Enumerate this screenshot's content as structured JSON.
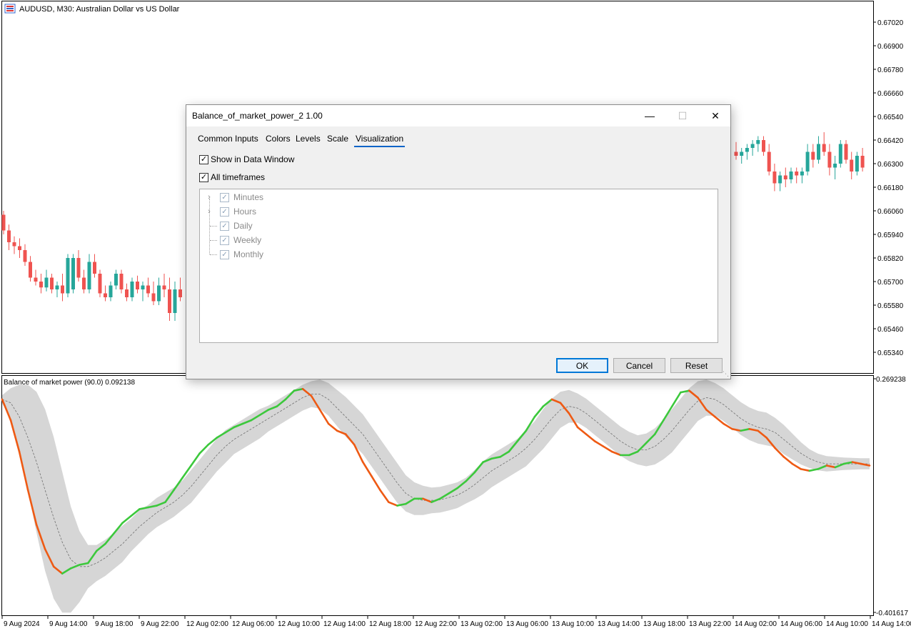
{
  "chart": {
    "symbol_title": "AUDUSD, M30:  Australian Dollar vs US Dollar",
    "price_ticks": [
      "0.67020",
      "0.66900",
      "0.66780",
      "0.66660",
      "0.66540",
      "0.66420",
      "0.66300",
      "0.66180",
      "0.66060",
      "0.65940",
      "0.65820",
      "0.65700",
      "0.65580",
      "0.65460",
      "0.65340"
    ],
    "indicator_title": "Balance of market power (90.0) 0.092138",
    "indicator_ticks": [
      "0.269238",
      "-0.401617"
    ],
    "time_ticks": [
      "9 Aug 2024",
      "9 Aug 14:00",
      "9 Aug 18:00",
      "9 Aug 22:00",
      "12 Aug 02:00",
      "12 Aug 06:00",
      "12 Aug 10:00",
      "12 Aug 14:00",
      "12 Aug 18:00",
      "12 Aug 22:00",
      "13 Aug 02:00",
      "13 Aug 06:00",
      "13 Aug 10:00",
      "13 Aug 14:00",
      "13 Aug 18:00",
      "13 Aug 22:00",
      "14 Aug 02:00",
      "14 Aug 06:00",
      "14 Aug 10:00",
      "14 Aug 14:00"
    ],
    "colors": {
      "bull": "#26a69a",
      "bear": "#ef5350",
      "up_line": "#3cc83c",
      "down_line": "#ee5a14",
      "band": "#d6d6d6",
      "signal": "#707070"
    },
    "candles_left": [
      [
        0.6604,
        0.6606,
        0.6594,
        0.6596
      ],
      [
        0.6596,
        0.6599,
        0.6586,
        0.659
      ],
      [
        0.659,
        0.6593,
        0.6584,
        0.6588
      ],
      [
        0.6588,
        0.6592,
        0.6582,
        0.6586
      ],
      [
        0.6586,
        0.6589,
        0.6578,
        0.658
      ],
      [
        0.658,
        0.6583,
        0.657,
        0.6572
      ],
      [
        0.6572,
        0.6576,
        0.6568,
        0.657
      ],
      [
        0.657,
        0.6574,
        0.6564,
        0.6567
      ],
      [
        0.6567,
        0.6576,
        0.6565,
        0.6572
      ],
      [
        0.6572,
        0.6574,
        0.6564,
        0.6566
      ],
      [
        0.6566,
        0.657,
        0.6562,
        0.6568
      ],
      [
        0.6568,
        0.6574,
        0.656,
        0.6564
      ],
      [
        0.6564,
        0.6584,
        0.6562,
        0.6582
      ],
      [
        0.6566,
        0.6584,
        0.6564,
        0.6582
      ],
      [
        0.6582,
        0.6586,
        0.657,
        0.6572
      ],
      [
        0.6572,
        0.6576,
        0.6564,
        0.6566
      ],
      [
        0.6566,
        0.6584,
        0.6564,
        0.658
      ],
      [
        0.658,
        0.6584,
        0.6572,
        0.6574
      ],
      [
        0.6574,
        0.6576,
        0.6562,
        0.6564
      ],
      [
        0.6564,
        0.6568,
        0.656,
        0.6562
      ],
      [
        0.6562,
        0.657,
        0.656,
        0.6568
      ],
      [
        0.6568,
        0.6576,
        0.6566,
        0.6574
      ],
      [
        0.6574,
        0.6576,
        0.6564,
        0.6566
      ],
      [
        0.6566,
        0.6569,
        0.656,
        0.6562
      ],
      [
        0.6562,
        0.6572,
        0.656,
        0.657
      ],
      [
        0.657,
        0.6573,
        0.6564,
        0.6566
      ],
      [
        0.6566,
        0.657,
        0.656,
        0.6568
      ],
      [
        0.6568,
        0.6572,
        0.6562,
        0.6564
      ],
      [
        0.6564,
        0.657,
        0.6558,
        0.656
      ],
      [
        0.656,
        0.6572,
        0.6558,
        0.6568
      ],
      [
        0.6568,
        0.6574,
        0.6562,
        0.6566
      ],
      [
        0.6566,
        0.6572,
        0.655,
        0.6554
      ],
      [
        0.6554,
        0.657,
        0.655,
        0.6566
      ],
      [
        0.6566,
        0.6572,
        0.656,
        0.6562
      ]
    ],
    "candles_right": [
      [
        0.6636,
        0.6641,
        0.6632,
        0.6634
      ],
      [
        0.6634,
        0.6638,
        0.663,
        0.6636
      ],
      [
        0.6636,
        0.664,
        0.6632,
        0.6638
      ],
      [
        0.6638,
        0.6642,
        0.6634,
        0.664
      ],
      [
        0.664,
        0.6644,
        0.6636,
        0.6642
      ],
      [
        0.6642,
        0.6644,
        0.6634,
        0.6636
      ],
      [
        0.6636,
        0.664,
        0.6624,
        0.6626
      ],
      [
        0.6626,
        0.663,
        0.6616,
        0.662
      ],
      [
        0.662,
        0.6626,
        0.6616,
        0.6624
      ],
      [
        0.6624,
        0.6628,
        0.6618,
        0.6622
      ],
      [
        0.6622,
        0.6628,
        0.662,
        0.6626
      ],
      [
        0.6626,
        0.6628,
        0.662,
        0.6624
      ],
      [
        0.6624,
        0.6628,
        0.662,
        0.6626
      ],
      [
        0.6626,
        0.664,
        0.6624,
        0.6636
      ],
      [
        0.6636,
        0.664,
        0.6628,
        0.6632
      ],
      [
        0.6632,
        0.6644,
        0.663,
        0.664
      ],
      [
        0.664,
        0.6646,
        0.6634,
        0.6636
      ],
      [
        0.6636,
        0.664,
        0.6624,
        0.6628
      ],
      [
        0.6628,
        0.6634,
        0.6622,
        0.663
      ],
      [
        0.663,
        0.6642,
        0.6628,
        0.664
      ],
      [
        0.664,
        0.6642,
        0.663,
        0.6632
      ],
      [
        0.6632,
        0.6636,
        0.6622,
        0.6626
      ],
      [
        0.6626,
        0.6636,
        0.6624,
        0.6634
      ],
      [
        0.6634,
        0.6638,
        0.6626,
        0.6628
      ]
    ],
    "balance_line": [
      0.21,
      0.15,
      0.06,
      -0.05,
      -0.15,
      -0.22,
      -0.27,
      -0.29,
      -0.275,
      -0.265,
      -0.26,
      -0.225,
      -0.205,
      -0.175,
      -0.145,
      -0.125,
      -0.105,
      -0.1,
      -0.095,
      -0.085,
      -0.05,
      -0.015,
      0.02,
      0.055,
      0.08,
      0.1,
      0.115,
      0.13,
      0.14,
      0.15,
      0.165,
      0.18,
      0.19,
      0.21,
      0.235,
      0.24,
      0.22,
      0.18,
      0.14,
      0.12,
      0.11,
      0.08,
      0.03,
      -0.01,
      -0.05,
      -0.085,
      -0.095,
      -0.09,
      -0.075,
      -0.075,
      -0.085,
      -0.075,
      -0.06,
      -0.045,
      -0.025,
      0.0,
      0.03,
      0.04,
      0.045,
      0.06,
      0.09,
      0.12,
      0.16,
      0.19,
      0.21,
      0.2,
      0.17,
      0.13,
      0.11,
      0.09,
      0.075,
      0.06,
      0.05,
      0.05,
      0.06,
      0.085,
      0.11,
      0.15,
      0.19,
      0.23,
      0.235,
      0.215,
      0.18,
      0.16,
      0.14,
      0.125,
      0.12,
      0.125,
      0.12,
      0.1,
      0.07,
      0.045,
      0.025,
      0.01,
      0.005,
      0.01,
      0.02,
      0.015,
      0.025,
      0.03,
      0.025,
      0.02
    ],
    "balance_signal": [
      0.21,
      0.2,
      0.16,
      0.1,
      0.03,
      -0.05,
      -0.13,
      -0.2,
      -0.25,
      -0.27,
      -0.27,
      -0.26,
      -0.245,
      -0.225,
      -0.205,
      -0.18,
      -0.155,
      -0.135,
      -0.115,
      -0.1,
      -0.085,
      -0.065,
      -0.04,
      -0.01,
      0.02,
      0.05,
      0.075,
      0.095,
      0.11,
      0.125,
      0.14,
      0.155,
      0.17,
      0.185,
      0.2,
      0.215,
      0.225,
      0.225,
      0.21,
      0.185,
      0.16,
      0.135,
      0.11,
      0.075,
      0.04,
      0.005,
      -0.03,
      -0.06,
      -0.075,
      -0.08,
      -0.08,
      -0.078,
      -0.072,
      -0.065,
      -0.052,
      -0.035,
      -0.015,
      0.005,
      0.02,
      0.035,
      0.05,
      0.07,
      0.095,
      0.125,
      0.155,
      0.18,
      0.19,
      0.185,
      0.17,
      0.15,
      0.13,
      0.11,
      0.09,
      0.075,
      0.065,
      0.065,
      0.075,
      0.095,
      0.12,
      0.15,
      0.18,
      0.205,
      0.215,
      0.21,
      0.195,
      0.175,
      0.155,
      0.14,
      0.13,
      0.125,
      0.115,
      0.095,
      0.075,
      0.055,
      0.04,
      0.03,
      0.025,
      0.025,
      0.025,
      0.025,
      0.025,
      0.025
    ],
    "balance_band_width": [
      0.0,
      0.03,
      0.08,
      0.14,
      0.19,
      0.22,
      0.22,
      0.19,
      0.14,
      0.09,
      0.05,
      0.04,
      0.04,
      0.04,
      0.04,
      0.035,
      0.035,
      0.03,
      0.03,
      0.03,
      0.03,
      0.03,
      0.035,
      0.035,
      0.035,
      0.035,
      0.035,
      0.03,
      0.03,
      0.03,
      0.03,
      0.025,
      0.025,
      0.025,
      0.025,
      0.025,
      0.025,
      0.03,
      0.035,
      0.04,
      0.045,
      0.045,
      0.045,
      0.045,
      0.045,
      0.045,
      0.045,
      0.04,
      0.035,
      0.03,
      0.025,
      0.025,
      0.025,
      0.025,
      0.025,
      0.03,
      0.035,
      0.035,
      0.035,
      0.035,
      0.035,
      0.04,
      0.04,
      0.045,
      0.045,
      0.04,
      0.035,
      0.03,
      0.03,
      0.03,
      0.03,
      0.03,
      0.03,
      0.03,
      0.03,
      0.035,
      0.04,
      0.045,
      0.05,
      0.05,
      0.05,
      0.045,
      0.04,
      0.035,
      0.035,
      0.035,
      0.035,
      0.035,
      0.035,
      0.035,
      0.03,
      0.03,
      0.025,
      0.02,
      0.015,
      0.012,
      0.01,
      0.008,
      0.006,
      0.005,
      0.004,
      0.004
    ]
  },
  "dialog": {
    "title": "Balance_of_market_power_2 1.00",
    "tabs": [
      "Common",
      "Inputs",
      "Colors",
      "Levels",
      "Scale",
      "Visualization"
    ],
    "show_in_data_window": "Show in Data Window",
    "all_timeframes": "All timeframes",
    "tree": [
      "Minutes",
      "Hours",
      "Daily",
      "Weekly",
      "Monthly"
    ],
    "ok": "OK",
    "cancel": "Cancel",
    "reset": "Reset"
  }
}
